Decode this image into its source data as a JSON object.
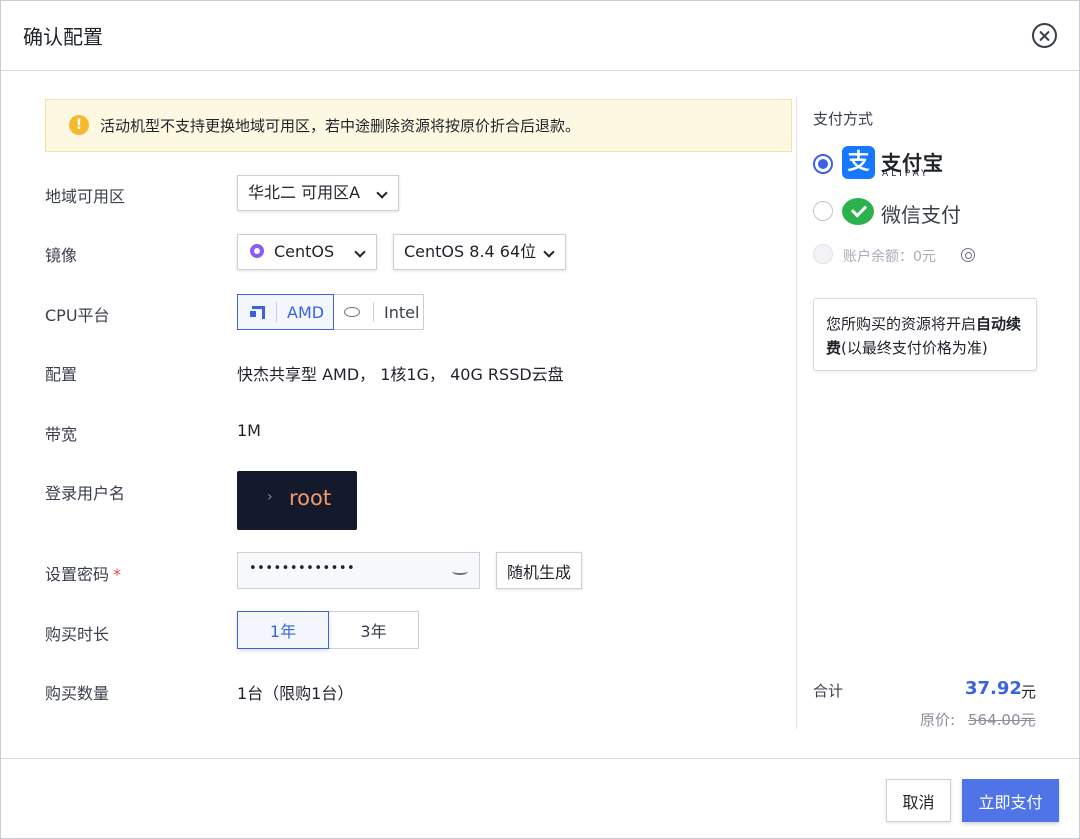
{
  "dialog": {
    "title": "确认配置"
  },
  "notice": {
    "text": "活动机型不支持更换地域可用区，若中途删除资源将按原价折合后退款。",
    "icon": "!"
  },
  "form": {
    "region": {
      "label": "地域可用区",
      "value": "华北二 可用区A"
    },
    "image": {
      "label": "镜像",
      "os": "CentOS",
      "version": "CentOS 8.4 64位"
    },
    "cpu": {
      "label": "CPU平台",
      "options": [
        "AMD",
        "Intel"
      ],
      "selected": "AMD"
    },
    "config": {
      "label": "配置",
      "value": "快杰共享型 AMD， 1核1G， 40G RSSD云盘"
    },
    "bandwidth": {
      "label": "带宽",
      "value": "1M"
    },
    "login": {
      "label": "登录用户名",
      "prompt": "›",
      "username": "root"
    },
    "password": {
      "label": "设置密码",
      "required_mark": "*",
      "masked_value": "•••••••••••••",
      "generate_label": "随机生成"
    },
    "duration": {
      "label": "购买时长",
      "options": [
        "1年",
        "3年"
      ],
      "selected": "1年"
    },
    "quantity": {
      "label": "购买数量",
      "value": "1台（限购1台）"
    }
  },
  "payment": {
    "title": "支付方式",
    "alipay": {
      "brand": "支付宝",
      "sub": "ALIPAY",
      "glyph": "支",
      "selected": true
    },
    "wechat": {
      "label": "微信支付",
      "selected": false
    },
    "balance": {
      "label": "账户余额：0元",
      "disabled": true
    },
    "renew_note_prefix": "您所购买的资源将开启",
    "renew_note_bold": "自动续费",
    "renew_note_suffix": "(以最终支付价格为准)",
    "total_label": "合计",
    "total_amount": "37.92",
    "total_unit": "元",
    "original_label": "原价:",
    "original_amount": "564.00元"
  },
  "footer": {
    "cancel_label": "取消",
    "pay_label": "立即支付"
  },
  "colors": {
    "accent": "#3b63e0",
    "pay_button": "#4f74e8",
    "notice_bg": "#fdf8e1",
    "warning": "#f5b92d",
    "alipay": "#1677ff",
    "wechat": "#2bb24c",
    "terminal_bg": "#141a2b",
    "terminal_text": "#f29a6a"
  }
}
